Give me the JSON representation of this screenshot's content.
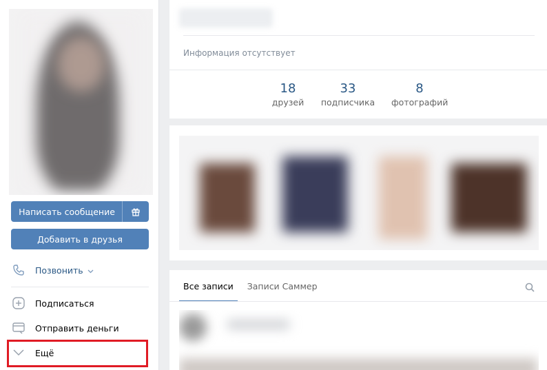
{
  "profile": {
    "buttons": {
      "message": "Написать сообщение",
      "add_friend": "Добавить в друзья"
    },
    "actions": {
      "call": "Позвонить",
      "subscribe": "Подписаться",
      "send_money": "Отправить деньги",
      "more": "Ещё"
    }
  },
  "info": {
    "status": "Информация отсутствует",
    "counters": [
      {
        "value": "18",
        "label": "друзей"
      },
      {
        "value": "33",
        "label": "подписчика"
      },
      {
        "value": "8",
        "label": "фотографий"
      }
    ]
  },
  "wall": {
    "tabs": [
      "Все записи",
      "Записи Саммер"
    ]
  },
  "colors": {
    "accent": "#5181b8",
    "link": "#2a5885",
    "highlight": "#e01b24"
  }
}
